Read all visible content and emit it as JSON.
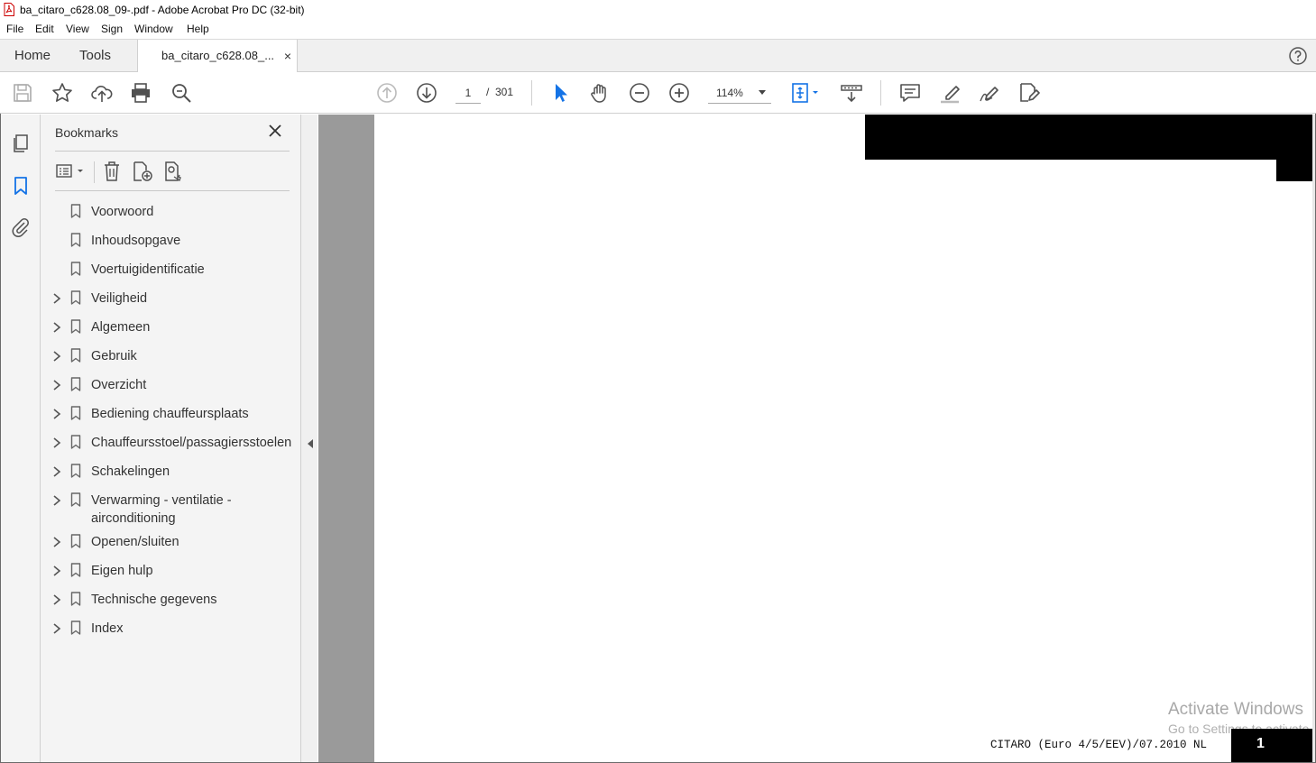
{
  "window": {
    "title": "ba_citaro_c628.08_09-.pdf - Adobe Acrobat Pro DC (32-bit)"
  },
  "menu": {
    "items": [
      "File",
      "Edit",
      "View",
      "Sign",
      "Window",
      "Help"
    ]
  },
  "tabs": {
    "home": "Home",
    "tools": "Tools",
    "document": "ba_citaro_c628.08_...",
    "close": "×"
  },
  "toolbar": {
    "current_page": "1",
    "page_separator": "/",
    "total_pages": "301",
    "zoom": "114%"
  },
  "bookmarks": {
    "title": "Bookmarks",
    "items": [
      {
        "label": "Voorwoord",
        "expandable": false
      },
      {
        "label": "Inhoudsopgave",
        "expandable": false
      },
      {
        "label": "Voertuigidentificatie",
        "expandable": false
      },
      {
        "label": "Veiligheid",
        "expandable": true
      },
      {
        "label": "Algemeen",
        "expandable": true
      },
      {
        "label": "Gebruik",
        "expandable": true
      },
      {
        "label": "Overzicht",
        "expandable": true
      },
      {
        "label": "Bediening chauffeursplaats",
        "expandable": true
      },
      {
        "label": "Chauffeursstoel/passagiersstoelen",
        "expandable": true
      },
      {
        "label": "Schakelingen",
        "expandable": true
      },
      {
        "label": "Verwarming - ventilatie -",
        "label2": "airconditioning",
        "expandable": true
      },
      {
        "label": "Openen/sluiten",
        "expandable": true
      },
      {
        "label": "Eigen hulp",
        "expandable": true
      },
      {
        "label": "Technische gegevens",
        "expandable": true
      },
      {
        "label": "Index",
        "expandable": true
      }
    ]
  },
  "document": {
    "footer": "CITARO (Euro 4/5/EEV)/07.2010 NL",
    "page_number": "1"
  },
  "watermark": {
    "line1": "Activate Windows",
    "line2": "Go to Settings to activate Windows."
  },
  "colors": {
    "accent_blue": "#1473e6",
    "icon_gray": "#505050"
  }
}
